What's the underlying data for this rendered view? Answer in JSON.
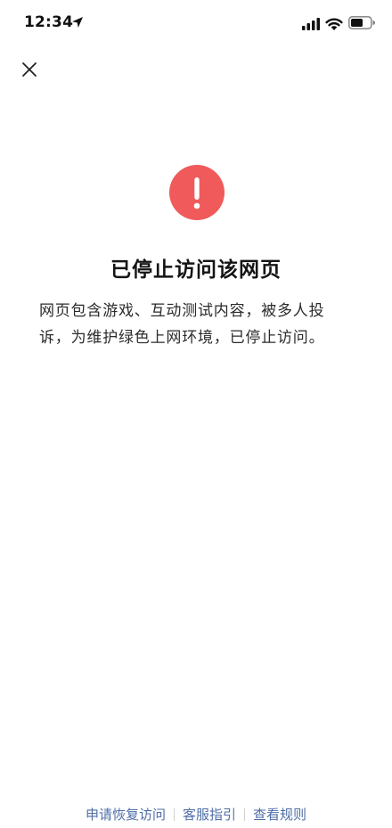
{
  "status_bar": {
    "time": "12:34"
  },
  "icons": {
    "close": "close-icon",
    "alert": "exclamation-icon"
  },
  "colors": {
    "alert_red": "#f05a5a",
    "link_blue": "#4f6ea8",
    "title_text": "#141414"
  },
  "main": {
    "title": "已停止访问该网页",
    "message": "网页包含游戏、互动测试内容，被多人投诉，为维护绿色上网环境，已停止访问。"
  },
  "footer": {
    "links": [
      {
        "label": "申请恢复访问"
      },
      {
        "label": "客服指引"
      },
      {
        "label": "查看规则"
      }
    ]
  }
}
